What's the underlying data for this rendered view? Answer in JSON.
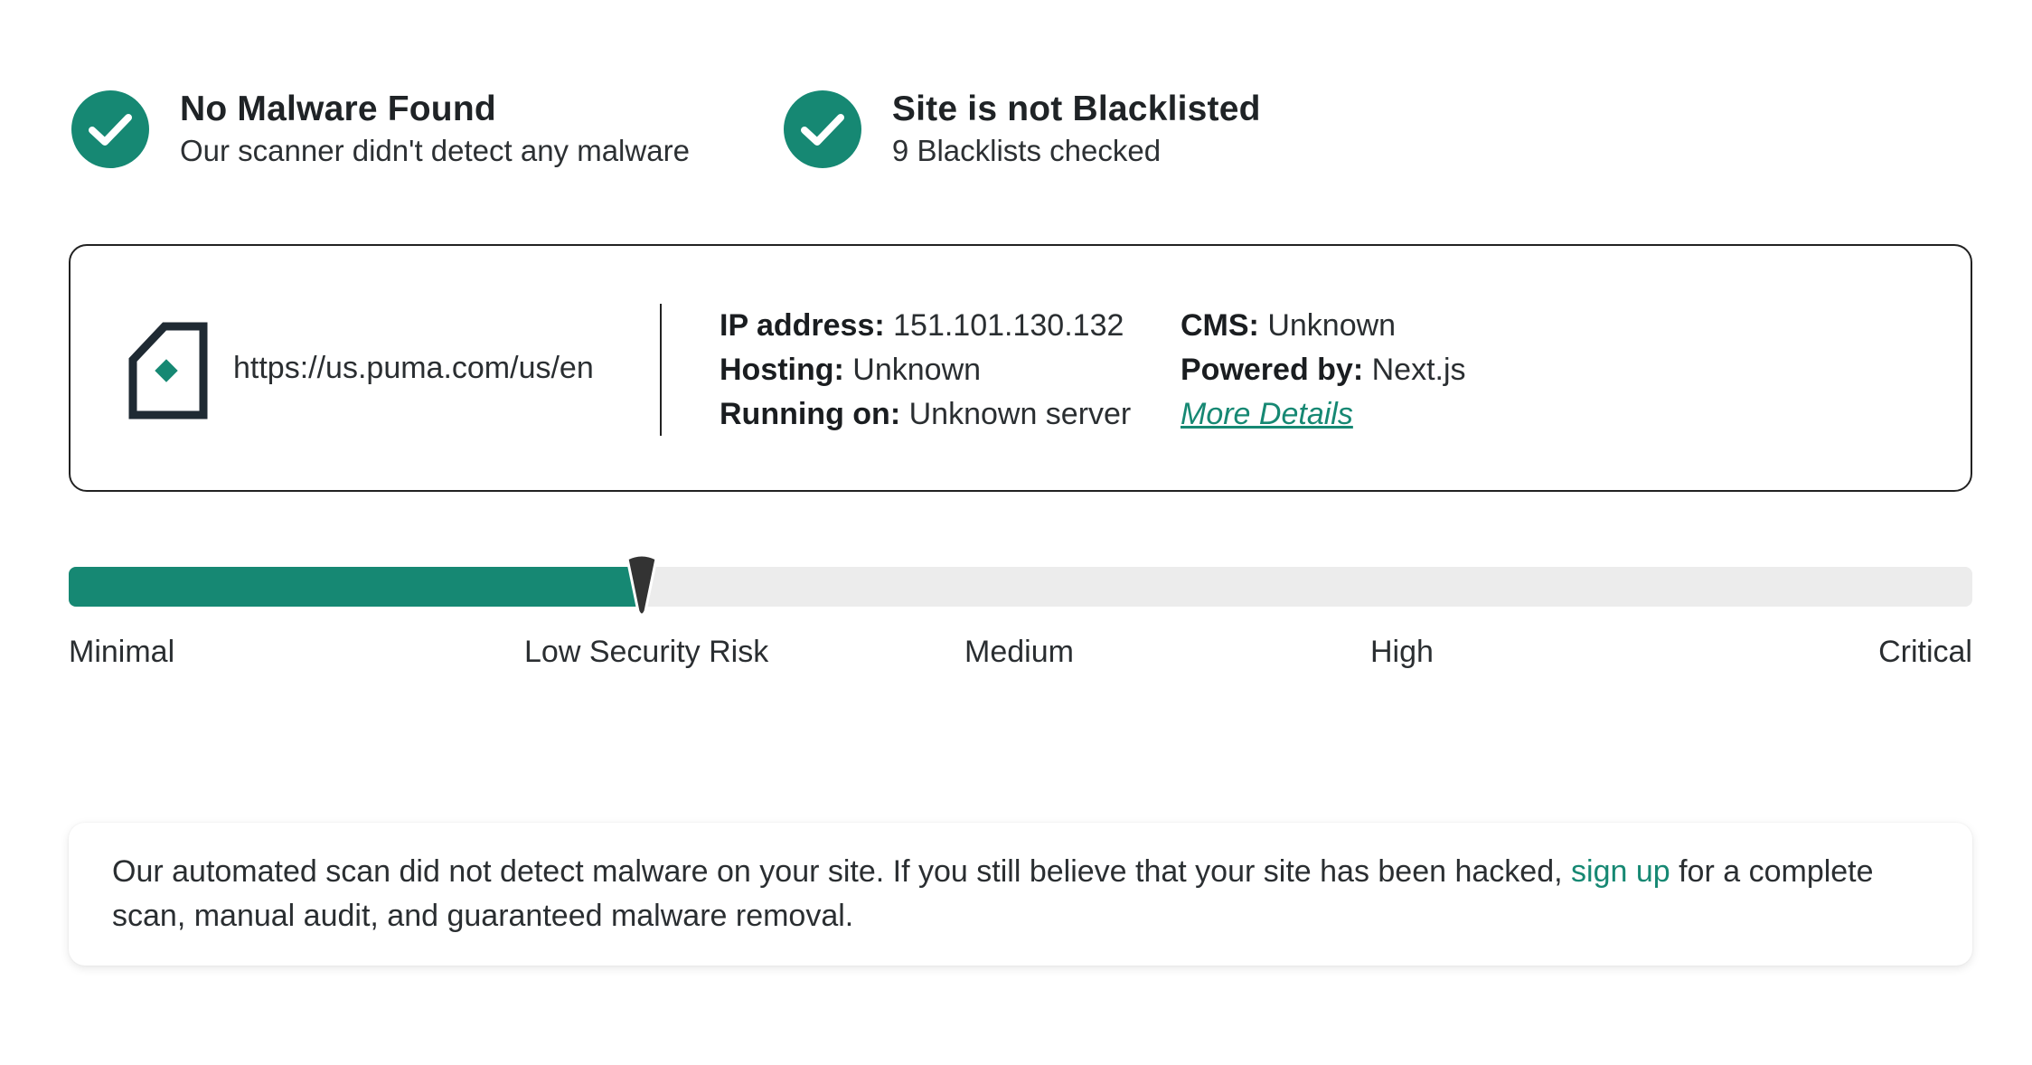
{
  "status": [
    {
      "title": "No Malware Found",
      "subtitle": "Our scanner didn't detect any malware"
    },
    {
      "title": "Site is not Blacklisted",
      "subtitle": "9 Blacklists checked"
    }
  ],
  "site": {
    "url": "https://us.puma.com/us/en",
    "ip_label": "IP address:",
    "ip_value": " 151.101.130.132",
    "hosting_label": "Hosting:",
    "hosting_value": " Unknown",
    "running_label": "Running on:",
    "running_value": " Unknown server",
    "cms_label": "CMS:",
    "cms_value": " Unknown",
    "powered_label": "Powered by:",
    "powered_value": " Next.js",
    "more_details": "More Details"
  },
  "risk": {
    "labels": [
      "Minimal",
      "Low Security Risk",
      "Medium",
      "High",
      "Critical"
    ],
    "current_level": "Low Security Risk",
    "fill_fraction": 0.3
  },
  "notice": {
    "text_before": "Our automated scan did not detect malware on your site. If you still believe that your site has been hacked, ",
    "link": "sign up",
    "text_after": " for a complete scan, manual audit, and guaranteed malware removal."
  },
  "colors": {
    "accent": "#168873",
    "track": "#ececec",
    "marker": "#333333"
  }
}
